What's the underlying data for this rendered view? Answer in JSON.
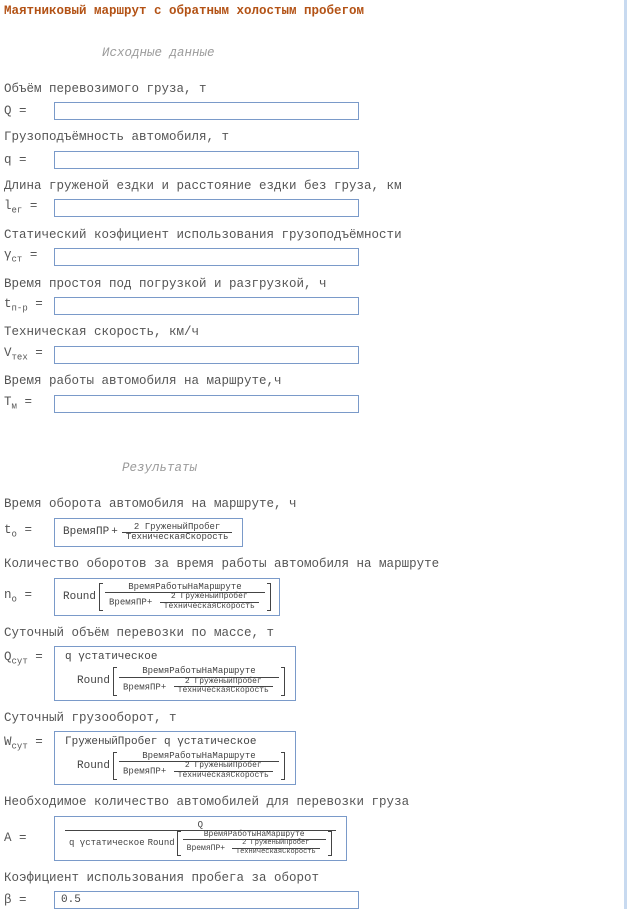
{
  "title": "Маятниковый маршрут с обратным холостым пробегом",
  "section_inputs": "Исходные данные",
  "section_results": "Результаты",
  "vars": {
    "Q": {
      "main": "Q",
      "sub": "",
      "eq": "="
    },
    "q": {
      "main": "q",
      "sub": "",
      "eq": "="
    },
    "ler": {
      "main": "l",
      "sub": "ег",
      "eq": "="
    },
    "gst": {
      "main": "γ",
      "sub": "ст",
      "eq": "="
    },
    "tpr": {
      "main": "t",
      "sub": "п-р",
      "eq": "="
    },
    "Vtex": {
      "main": "V",
      "sub": "тех",
      "eq": "="
    },
    "Tm": {
      "main": "T",
      "sub": "м",
      "eq": "="
    },
    "to": {
      "main": "t",
      "sub": "о",
      "eq": "="
    },
    "no": {
      "main": "n",
      "sub": "о",
      "eq": "="
    },
    "Qsut": {
      "main": "Q",
      "sub": "сут",
      "eq": "="
    },
    "Wsut": {
      "main": "W",
      "sub": "сут",
      "eq": "="
    },
    "A": {
      "main": "A",
      "sub": "",
      "eq": "="
    },
    "beta": {
      "main": "β",
      "sub": "",
      "eq": "="
    }
  },
  "labels": {
    "Q": "Объём перевозимого груза, т",
    "q": "Грузоподъёмность автомобиля, т",
    "ler": "Длина груженой ездки и расстояние ездки без груза, км",
    "gst": "Статический коэфициент использования грузоподъёмности",
    "tpr": "Время простоя под погрузкой и разгрузкой, ч",
    "Vtex": "Техническая скорость, км/ч",
    "Tm": "Время работы автомобиля на маршруте,ч",
    "to": "Время оборота автомобиля на маршруте, ч",
    "no": "Количество оборотов за время работы автомобиля на маршруте",
    "Qsut": "Суточный объём перевозки по массе, т",
    "Wsut": "Суточный грузооборот, т",
    "A": "Необходимое количество автомобилей для перевозки груза",
    "beta": "Коэфициент использования пробега за оборот"
  },
  "input_values": {
    "Q": "",
    "q": "",
    "ler": "",
    "gst": "",
    "tpr": "",
    "Vtex": "",
    "Tm": ""
  },
  "tokens": {
    "VremyaPR": "ВремяПР",
    "plus": "+",
    "two": "2",
    "GruzhenyiProbeg": "ГруженыйПробег",
    "TekhSkorost": "ТехническаяСкорость",
    "Round": "Round",
    "VremyaRaboty": "ВремяРаботыНаМаршруте",
    "q_gamma_stat": "q γстатическое",
    "gruz_q_gamma": "ГруженыйПробег q γстатическое",
    "Q_token": "Q"
  },
  "beta_value": "0.5"
}
